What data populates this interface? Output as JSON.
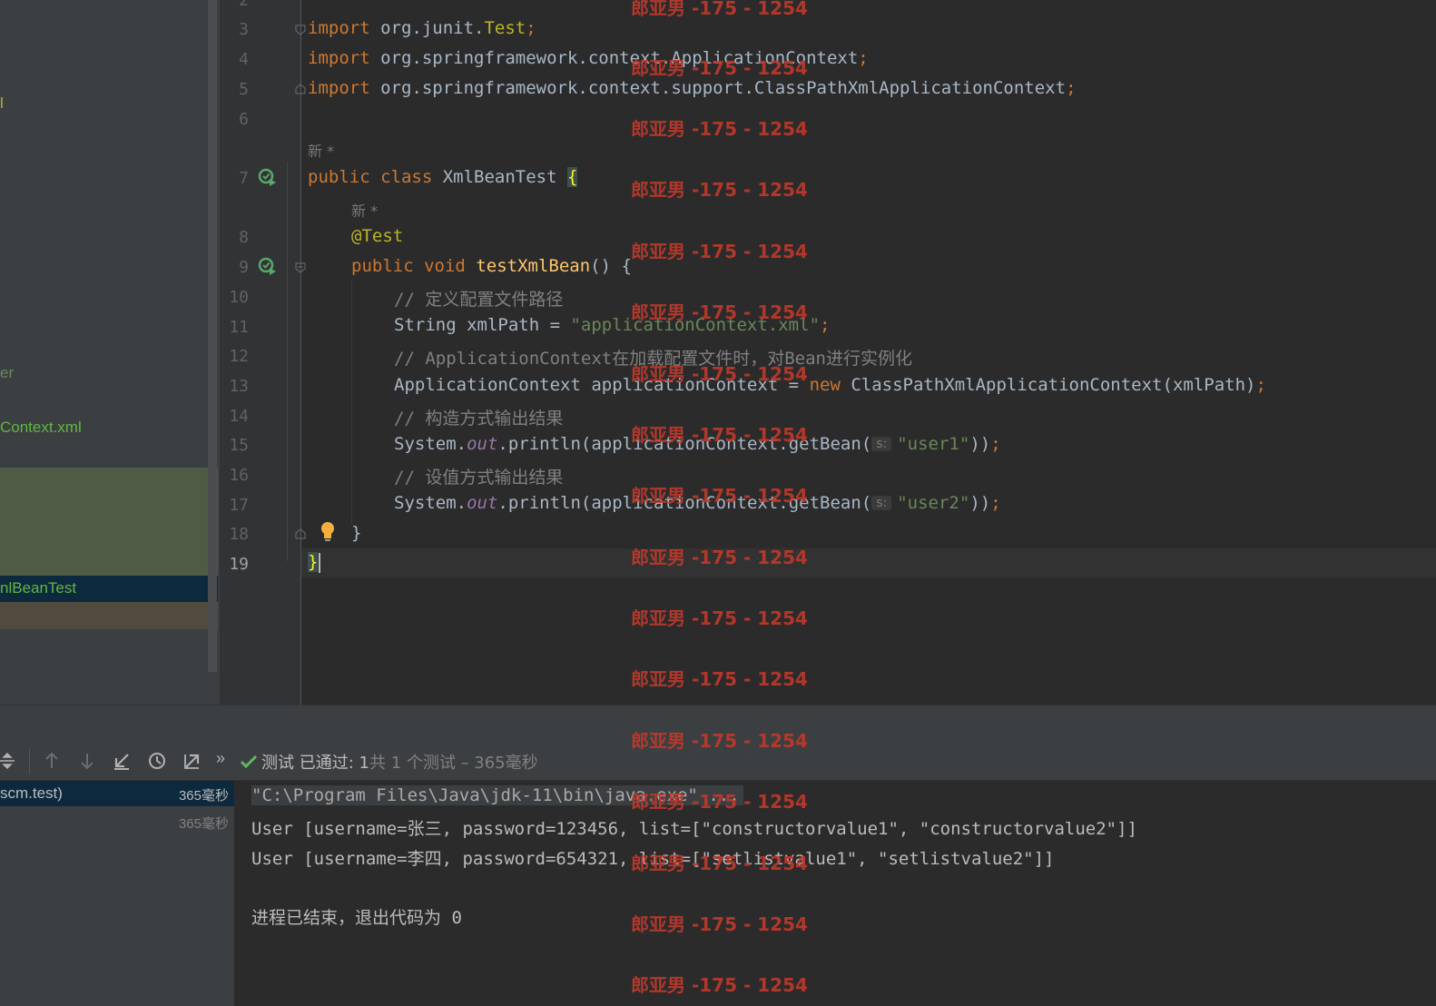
{
  "project_panel": {
    "items": [
      {
        "text": "l",
        "color": "#bbb529"
      },
      {
        "text": "er",
        "color": "#6a8759"
      },
      {
        "text": "Context.xml",
        "color": "#62b543"
      },
      {
        "text": "nlBeanTest",
        "color": "#62b543"
      }
    ]
  },
  "editor": {
    "line_numbers": [
      "2",
      "3",
      "4",
      "5",
      "6",
      "7",
      "8",
      "9",
      "10",
      "11",
      "12",
      "13",
      "14",
      "15",
      "16",
      "17",
      "18",
      "19"
    ],
    "author_hint": "新 *",
    "code": {
      "l3_kw": "import",
      "l3_pkg": " org.junit.",
      "l3_cls": "Test",
      "l3_end": ";",
      "l4_kw": "import",
      "l4_pkg": " org.springframework.context.ApplicationContext",
      "l4_end": ";",
      "l5_kw": "import",
      "l5_pkg": " org.springframework.context.support.ClassPathXmlApplicationContext",
      "l5_end": ";",
      "l7_kw1": "public",
      "l7_kw2": "class",
      "l7_name": " XmlBeanTest ",
      "l7_brace": "{",
      "l8_ann": "@Test",
      "l9_kw1": "public",
      "l9_kw2": "void",
      "l9_fn": "testXmlBean",
      "l9_rest": "() {",
      "l10_cmt": "// 定义配置文件路径",
      "l11_a": "String xmlPath = ",
      "l11_str": "\"applicationContext.xml\"",
      "l11_end": ";",
      "l12_cmt": "// ApplicationContext在加载配置文件时，对Bean进行实例化",
      "l13_a": "ApplicationContext applicationContext = ",
      "l13_kw": "new",
      "l13_b": " ClassPathXmlApplicationContext(xmlPath)",
      "l13_end": ";",
      "l14_cmt": "// 构造方式输出结果",
      "l15_a": "System.",
      "l15_out": "out",
      "l15_b": ".println(applicationContext.getBean(",
      "l15_hint": "s:",
      "l15_str": "\"user1\"",
      "l15_c": "))",
      "l15_end": ";",
      "l16_cmt": "// 设值方式输出结果",
      "l17_a": "System.",
      "l17_out": "out",
      "l17_b": ".println(applicationContext.getBean(",
      "l17_hint": "s:",
      "l17_str": "\"user2\"",
      "l17_c": "))",
      "l17_end": ";",
      "l18": "}",
      "l19": "}"
    }
  },
  "run_panel": {
    "status_passed": "测试 已通过: 1",
    "status_detail": "共 1 个测试 – 365毫秒",
    "more_label": "»",
    "tree": [
      {
        "label": "scm.test)",
        "duration": "365毫秒"
      },
      {
        "label": "",
        "duration": "365毫秒"
      }
    ],
    "console": [
      "\"C:\\Program Files\\Java\\jdk-11\\bin\\java.exe\" ...",
      "User [username=张三, password=123456, list=[\"constructorvalue1\", \"constructorvalue2\"]]",
      "User [username=李四, password=654321, list=[\"setlistvalue1\", \"setlistvalue2\"]]",
      "",
      "进程已结束，退出代码为 0"
    ]
  },
  "watermark": "郎亚男 -175 - 1254",
  "colors": {
    "keyword": "#cc7832",
    "annotation": "#bbb529",
    "string": "#6a8759",
    "comment": "#808080",
    "method": "#ffc66d",
    "field": "#9876aa",
    "watermark": "#c0392b",
    "passed": "#5fb761"
  }
}
